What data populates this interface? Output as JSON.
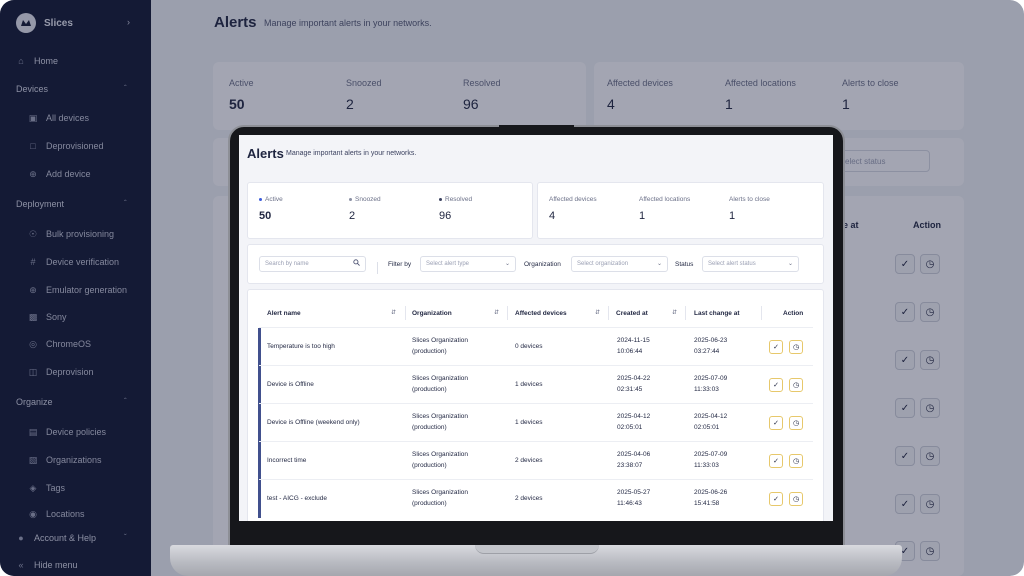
{
  "app": {
    "brand": "Slices",
    "brand_logo": "Slices"
  },
  "sidebar": {
    "home": {
      "label": "Home",
      "icon": "home-icon"
    },
    "devices": {
      "label": "Devices",
      "items": [
        {
          "label": "All devices",
          "icon": "devices-icon"
        },
        {
          "label": "Deprovisioned",
          "icon": "deprovisioned-icon"
        },
        {
          "label": "Add device",
          "icon": "plus-circle-icon"
        }
      ]
    },
    "deployment": {
      "label": "Deployment",
      "items": [
        {
          "label": "Bulk provisioning",
          "icon": "bulk-icon"
        },
        {
          "label": "Device verification",
          "icon": "hash-icon"
        },
        {
          "label": "Emulator generation",
          "icon": "plus-circle-icon"
        },
        {
          "label": "Sony",
          "icon": "sony-icon"
        },
        {
          "label": "ChromeOS",
          "icon": "chrome-icon"
        },
        {
          "label": "Deprovision",
          "icon": "trash-icon"
        }
      ]
    },
    "organize": {
      "label": "Organize",
      "items": [
        {
          "label": "Device policies",
          "icon": "policy-icon"
        },
        {
          "label": "Organizations",
          "icon": "building-icon"
        },
        {
          "label": "Tags",
          "icon": "tag-icon"
        },
        {
          "label": "Locations",
          "icon": "location-icon"
        }
      ]
    },
    "account": {
      "label": "Account & Help",
      "icon": "user-icon"
    },
    "hide_menu": {
      "label": "Hide menu",
      "icon": "double-chevron-left-icon"
    }
  },
  "page": {
    "title": "Alerts",
    "subtitle": "Manage important alerts in your networks."
  },
  "stats": {
    "active": {
      "label": "Active",
      "value": "50",
      "color": "#3b5bdb"
    },
    "snoozed": {
      "label": "Snoozed",
      "value": "2",
      "color": "#8a8fa3"
    },
    "resolved": {
      "label": "Resolved",
      "value": "96",
      "color": "#3c4260"
    },
    "affected_devices": {
      "label": "Affected devices",
      "value": "4"
    },
    "affected_locations": {
      "label": "Affected locations",
      "value": "1"
    },
    "alerts_to_close": {
      "label": "Alerts to close",
      "value": "1"
    }
  },
  "filters": {
    "search_placeholder": "Search by name",
    "filter_by_label": "Filter by",
    "alert_type_placeholder": "Select alert type",
    "organization_label": "Organization",
    "organization_placeholder": "Select organization",
    "status_label": "Status",
    "status_placeholder": "Select alert status"
  },
  "table": {
    "columns": [
      "Alert name",
      "Organization",
      "Affected devices",
      "Created at",
      "Last change at",
      "Action"
    ],
    "rows": [
      {
        "name": "Temperature is too high",
        "org1": "Slices Organization",
        "org2": "(production)",
        "devices": "0 devices",
        "created_d": "2024-11-15",
        "created_t": "10:06:44",
        "changed_d": "2025-06-23",
        "changed_t": "03:27:44"
      },
      {
        "name": "Device is Offline",
        "org1": "Slices Organization",
        "org2": "(production)",
        "devices": "1 devices",
        "created_d": "2025-04-22",
        "created_t": "02:31:45",
        "changed_d": "2025-07-09",
        "changed_t": "11:33:03"
      },
      {
        "name": "Device is Offline (weekend only)",
        "org1": "Slices Organization",
        "org2": "(production)",
        "devices": "1 devices",
        "created_d": "2025-04-12",
        "created_t": "02:05:01",
        "changed_d": "2025-04-12",
        "changed_t": "02:05:01"
      },
      {
        "name": "Incorrect time",
        "org1": "Slices Organization",
        "org2": "(production)",
        "devices": "2 devices",
        "created_d": "2025-04-06",
        "created_t": "23:38:07",
        "changed_d": "2025-07-09",
        "changed_t": "11:33:03"
      },
      {
        "name": "test - AICG - exclude",
        "org1": "Slices Organization",
        "org2": "(production)",
        "devices": "2 devices",
        "created_d": "2025-05-27",
        "created_t": "11:46:43",
        "changed_d": "2025-06-26",
        "changed_t": "15:41:58"
      }
    ]
  },
  "background": {
    "action_header": "Action",
    "partial_header": "e at",
    "status_select_partial": "elect status"
  },
  "colors": {
    "sidebar": "#141a35",
    "accent": "#41508d",
    "action_border": "#e7c86b"
  }
}
